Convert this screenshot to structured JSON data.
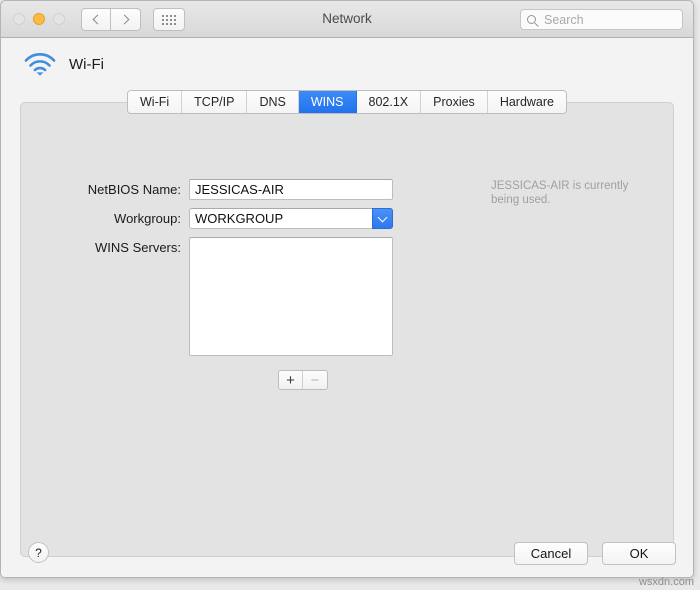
{
  "window": {
    "title": "Network",
    "traffic_lights": [
      {
        "name": "close",
        "color": "#e4e4e4",
        "state": "inactive"
      },
      {
        "name": "minimize",
        "color": "#fdbc40",
        "state": "active"
      },
      {
        "name": "zoom",
        "color": "#e4e4e4",
        "state": "inactive"
      }
    ]
  },
  "toolbar": {
    "back_icon": "chevron-left-icon",
    "forward_icon": "chevron-right-icon",
    "showall_icon": "grid-icon",
    "search": {
      "icon": "search-icon",
      "value": "",
      "placeholder": "Search"
    }
  },
  "service": {
    "icon": "wifi-icon",
    "name": "Wi-Fi"
  },
  "tabs": [
    {
      "label": "Wi-Fi",
      "selected": false
    },
    {
      "label": "TCP/IP",
      "selected": false
    },
    {
      "label": "DNS",
      "selected": false
    },
    {
      "label": "WINS",
      "selected": true
    },
    {
      "label": "802.1X",
      "selected": false
    },
    {
      "label": "Proxies",
      "selected": false
    },
    {
      "label": "Hardware",
      "selected": false
    }
  ],
  "form": {
    "netbios": {
      "label": "NetBIOS Name:",
      "value": "JESSICAS-AIR",
      "placeholder": ""
    },
    "workgroup": {
      "label": "Workgroup:",
      "value": "WORKGROUP"
    },
    "wins_servers": {
      "label": "WINS Servers:",
      "items": [],
      "add_label": "+",
      "remove_label": "−"
    },
    "hint": "JESSICAS-AIR is currently being used."
  },
  "footer": {
    "help_label": "?",
    "cancel_label": "Cancel",
    "ok_label": "OK"
  },
  "watermark": "wsxdn.com",
  "colors": {
    "accent_blue": "#2C78EF",
    "minimize_amber": "#FDBC40",
    "panel_gray": "#E3E3E3",
    "hint_gray": "#A0A0A0"
  }
}
